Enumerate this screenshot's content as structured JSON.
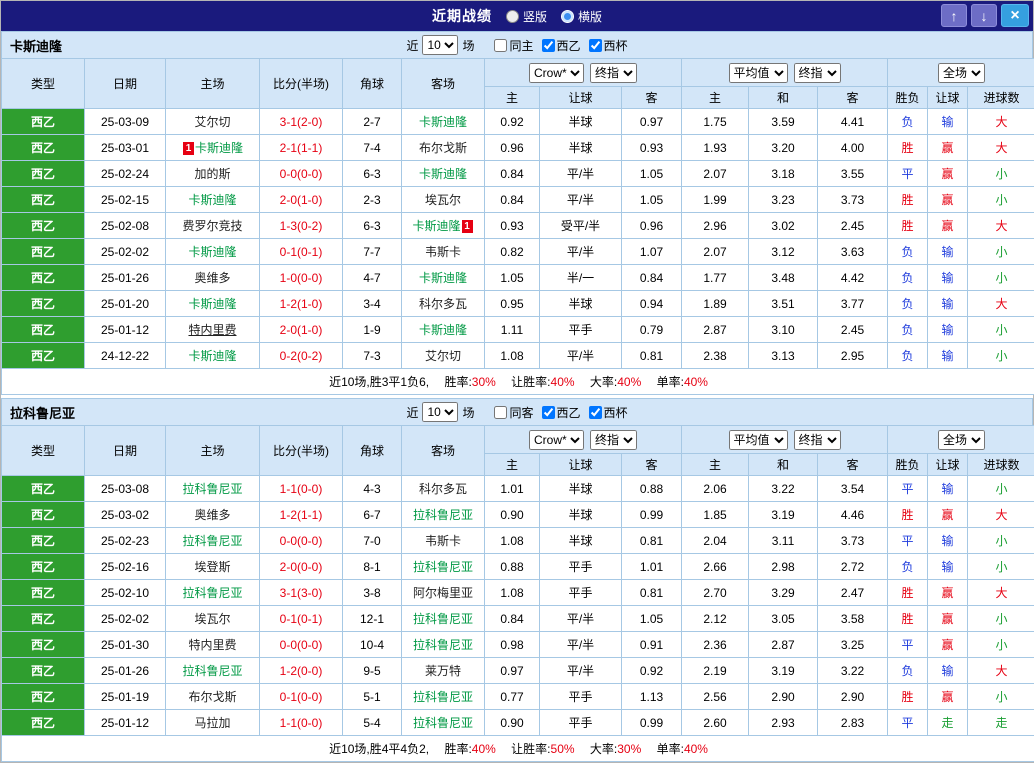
{
  "topbar": {
    "title": "近期战绩",
    "vertical_label": "竖版",
    "horizontal_label": "横版",
    "selected": "横版",
    "up_icon": "↑",
    "down_icon": "↓",
    "close_icon": "×",
    "bg_color": "#1a1a7d"
  },
  "labels": {
    "near": "近",
    "count": "10",
    "matches": "场",
    "league": "西乙",
    "cup": "西杯"
  },
  "dropdowns": {
    "company": "Crow*",
    "stage": "终指",
    "average": "平均值",
    "scope": "全场"
  },
  "columns": {
    "type": "类型",
    "date": "日期",
    "home": "主场",
    "score": "比分(半场)",
    "corner": "角球",
    "away": "客场",
    "odds_home": "主",
    "odds_handicap": "让球",
    "odds_away": "客",
    "avg_home": "主",
    "avg_draw": "和",
    "avg_away": "客",
    "result_outcome": "胜负",
    "result_handicap": "让球",
    "result_goals": "进球数"
  },
  "color_map": {
    "胜": "#e60012",
    "赢": "#e60012",
    "大": "#e60012",
    "负": "#1e3bdc",
    "输": "#1e3bdc",
    "平": "#1e3bdc",
    "小": "#1a9e32",
    "走": "#1a9e32"
  },
  "accent_colors": {
    "focus_team": "#009944",
    "score_red": "#e60012",
    "type_green": "#2f9e2f",
    "header_blue": "#d3e6f8"
  },
  "sections": [
    {
      "team": "卡斯迪隆",
      "same_label": "同主",
      "rows": [
        {
          "type": "西乙",
          "date": "25-03-09",
          "home": {
            "name": "艾尔切",
            "focus": false
          },
          "score": "3-1(2-0)",
          "corner": "2-7",
          "away": {
            "name": "卡斯迪隆",
            "focus": true
          },
          "odds": [
            "0.92",
            "半球",
            "0.97"
          ],
          "avg": [
            "1.75",
            "3.59",
            "4.41"
          ],
          "result": [
            "负",
            "输",
            "大"
          ]
        },
        {
          "type": "西乙",
          "date": "25-03-01",
          "home": {
            "name": "卡斯迪隆",
            "focus": true,
            "badge": "1",
            "badge_pos": "left"
          },
          "score": "2-1(1-1)",
          "corner": "7-4",
          "away": {
            "name": "布尔戈斯",
            "focus": false
          },
          "odds": [
            "0.96",
            "半球",
            "0.93"
          ],
          "avg": [
            "1.93",
            "3.20",
            "4.00"
          ],
          "result": [
            "胜",
            "赢",
            "大"
          ]
        },
        {
          "type": "西乙",
          "date": "25-02-24",
          "home": {
            "name": "加的斯",
            "focus": false
          },
          "score": "0-0(0-0)",
          "corner": "6-3",
          "away": {
            "name": "卡斯迪隆",
            "focus": true
          },
          "odds": [
            "0.84",
            "平/半",
            "1.05"
          ],
          "avg": [
            "2.07",
            "3.18",
            "3.55"
          ],
          "result": [
            "平",
            "赢",
            "小"
          ]
        },
        {
          "type": "西乙",
          "date": "25-02-15",
          "home": {
            "name": "卡斯迪隆",
            "focus": true
          },
          "score": "2-0(1-0)",
          "corner": "2-3",
          "away": {
            "name": "埃瓦尔",
            "focus": false
          },
          "odds": [
            "0.84",
            "平/半",
            "1.05"
          ],
          "avg": [
            "1.99",
            "3.23",
            "3.73"
          ],
          "result": [
            "胜",
            "赢",
            "小"
          ]
        },
        {
          "type": "西乙",
          "date": "25-02-08",
          "home": {
            "name": "费罗尔竞技",
            "focus": false
          },
          "score": "1-3(0-2)",
          "corner": "6-3",
          "away": {
            "name": "卡斯迪隆",
            "focus": true,
            "badge": "1",
            "badge_pos": "right"
          },
          "odds": [
            "0.93",
            "受平/半",
            "0.96"
          ],
          "avg": [
            "2.96",
            "3.02",
            "2.45"
          ],
          "result": [
            "胜",
            "赢",
            "大"
          ]
        },
        {
          "type": "西乙",
          "date": "25-02-02",
          "home": {
            "name": "卡斯迪隆",
            "focus": true
          },
          "score": "0-1(0-1)",
          "corner": "7-7",
          "away": {
            "name": "韦斯卡",
            "focus": false
          },
          "odds": [
            "0.82",
            "平/半",
            "1.07"
          ],
          "avg": [
            "2.07",
            "3.12",
            "3.63"
          ],
          "result": [
            "负",
            "输",
            "小"
          ]
        },
        {
          "type": "西乙",
          "date": "25-01-26",
          "home": {
            "name": "奥维多",
            "focus": false
          },
          "score": "1-0(0-0)",
          "corner": "4-7",
          "away": {
            "name": "卡斯迪隆",
            "focus": true
          },
          "odds": [
            "1.05",
            "半/一",
            "0.84"
          ],
          "avg": [
            "1.77",
            "3.48",
            "4.42"
          ],
          "result": [
            "负",
            "输",
            "小"
          ]
        },
        {
          "type": "西乙",
          "date": "25-01-20",
          "home": {
            "name": "卡斯迪隆",
            "focus": true
          },
          "score": "1-2(1-0)",
          "corner": "3-4",
          "away": {
            "name": "科尔多瓦",
            "focus": false
          },
          "odds": [
            "0.95",
            "半球",
            "0.94"
          ],
          "avg": [
            "1.89",
            "3.51",
            "3.77"
          ],
          "result": [
            "负",
            "输",
            "大"
          ]
        },
        {
          "type": "西乙",
          "date": "25-01-12",
          "home": {
            "name": "特内里费",
            "focus": false,
            "underline": true
          },
          "score": "2-0(1-0)",
          "corner": "1-9",
          "away": {
            "name": "卡斯迪隆",
            "focus": true
          },
          "odds": [
            "1.11",
            "平手",
            "0.79"
          ],
          "avg": [
            "2.87",
            "3.10",
            "2.45"
          ],
          "result": [
            "负",
            "输",
            "小"
          ]
        },
        {
          "type": "西乙",
          "date": "24-12-22",
          "home": {
            "name": "卡斯迪隆",
            "focus": true
          },
          "score": "0-2(0-2)",
          "corner": "7-3",
          "away": {
            "name": "艾尔切",
            "focus": false
          },
          "odds": [
            "1.08",
            "平/半",
            "0.81"
          ],
          "avg": [
            "2.38",
            "3.13",
            "2.95"
          ],
          "result": [
            "负",
            "输",
            "小"
          ]
        }
      ],
      "summary": {
        "prefix": "近10场,胜3平1负6,",
        "stats": [
          {
            "label": "胜率:",
            "value": "30%"
          },
          {
            "label": "让胜率:",
            "value": "40%"
          },
          {
            "label": "大率:",
            "value": "40%"
          },
          {
            "label": "单率:",
            "value": "40%"
          }
        ]
      }
    },
    {
      "team": "拉科鲁尼亚",
      "same_label": "同客",
      "rows": [
        {
          "type": "西乙",
          "date": "25-03-08",
          "home": {
            "name": "拉科鲁尼亚",
            "focus": true
          },
          "score": "1-1(0-0)",
          "corner": "4-3",
          "away": {
            "name": "科尔多瓦",
            "focus": false
          },
          "odds": [
            "1.01",
            "半球",
            "0.88"
          ],
          "avg": [
            "2.06",
            "3.22",
            "3.54"
          ],
          "result": [
            "平",
            "输",
            "小"
          ]
        },
        {
          "type": "西乙",
          "date": "25-03-02",
          "home": {
            "name": "奥维多",
            "focus": false
          },
          "score": "1-2(1-1)",
          "corner": "6-7",
          "away": {
            "name": "拉科鲁尼亚",
            "focus": true
          },
          "odds": [
            "0.90",
            "半球",
            "0.99"
          ],
          "avg": [
            "1.85",
            "3.19",
            "4.46"
          ],
          "result": [
            "胜",
            "赢",
            "大"
          ]
        },
        {
          "type": "西乙",
          "date": "25-02-23",
          "home": {
            "name": "拉科鲁尼亚",
            "focus": true
          },
          "score": "0-0(0-0)",
          "corner": "7-0",
          "away": {
            "name": "韦斯卡",
            "focus": false
          },
          "odds": [
            "1.08",
            "半球",
            "0.81"
          ],
          "avg": [
            "2.04",
            "3.11",
            "3.73"
          ],
          "result": [
            "平",
            "输",
            "小"
          ]
        },
        {
          "type": "西乙",
          "date": "25-02-16",
          "home": {
            "name": "埃登斯",
            "focus": false
          },
          "score": "2-0(0-0)",
          "corner": "8-1",
          "away": {
            "name": "拉科鲁尼亚",
            "focus": true
          },
          "odds": [
            "0.88",
            "平手",
            "1.01"
          ],
          "avg": [
            "2.66",
            "2.98",
            "2.72"
          ],
          "result": [
            "负",
            "输",
            "小"
          ]
        },
        {
          "type": "西乙",
          "date": "25-02-10",
          "home": {
            "name": "拉科鲁尼亚",
            "focus": true
          },
          "score": "3-1(3-0)",
          "corner": "3-8",
          "away": {
            "name": "阿尔梅里亚",
            "focus": false
          },
          "odds": [
            "1.08",
            "平手",
            "0.81"
          ],
          "avg": [
            "2.70",
            "3.29",
            "2.47"
          ],
          "result": [
            "胜",
            "赢",
            "大"
          ]
        },
        {
          "type": "西乙",
          "date": "25-02-02",
          "home": {
            "name": "埃瓦尔",
            "focus": false
          },
          "score": "0-1(0-1)",
          "corner": "12-1",
          "away": {
            "name": "拉科鲁尼亚",
            "focus": true
          },
          "odds": [
            "0.84",
            "平/半",
            "1.05"
          ],
          "avg": [
            "2.12",
            "3.05",
            "3.58"
          ],
          "result": [
            "胜",
            "赢",
            "小"
          ]
        },
        {
          "type": "西乙",
          "date": "25-01-30",
          "home": {
            "name": "特内里费",
            "focus": false
          },
          "score": "0-0(0-0)",
          "corner": "10-4",
          "away": {
            "name": "拉科鲁尼亚",
            "focus": true
          },
          "odds": [
            "0.98",
            "平/半",
            "0.91"
          ],
          "avg": [
            "2.36",
            "2.87",
            "3.25"
          ],
          "result": [
            "平",
            "赢",
            "小"
          ]
        },
        {
          "type": "西乙",
          "date": "25-01-26",
          "home": {
            "name": "拉科鲁尼亚",
            "focus": true
          },
          "score": "1-2(0-0)",
          "corner": "9-5",
          "away": {
            "name": "莱万特",
            "focus": false
          },
          "odds": [
            "0.97",
            "平/半",
            "0.92"
          ],
          "avg": [
            "2.19",
            "3.19",
            "3.22"
          ],
          "result": [
            "负",
            "输",
            "大"
          ]
        },
        {
          "type": "西乙",
          "date": "25-01-19",
          "home": {
            "name": "布尔戈斯",
            "focus": false
          },
          "score": "0-1(0-0)",
          "corner": "5-1",
          "away": {
            "name": "拉科鲁尼亚",
            "focus": true
          },
          "odds": [
            "0.77",
            "平手",
            "1.13"
          ],
          "avg": [
            "2.56",
            "2.90",
            "2.90"
          ],
          "result": [
            "胜",
            "赢",
            "小"
          ]
        },
        {
          "type": "西乙",
          "date": "25-01-12",
          "home": {
            "name": "马拉加",
            "focus": false
          },
          "score": "1-1(0-0)",
          "corner": "5-4",
          "away": {
            "name": "拉科鲁尼亚",
            "focus": true
          },
          "odds": [
            "0.90",
            "平手",
            "0.99"
          ],
          "avg": [
            "2.60",
            "2.93",
            "2.83"
          ],
          "result": [
            "平",
            "走",
            "走"
          ]
        }
      ],
      "summary": {
        "prefix": "近10场,胜4平4负2,",
        "stats": [
          {
            "label": "胜率:",
            "value": "40%"
          },
          {
            "label": "让胜率:",
            "value": "50%"
          },
          {
            "label": "大率:",
            "value": "30%"
          },
          {
            "label": "单率:",
            "value": "40%"
          }
        ]
      }
    }
  ]
}
